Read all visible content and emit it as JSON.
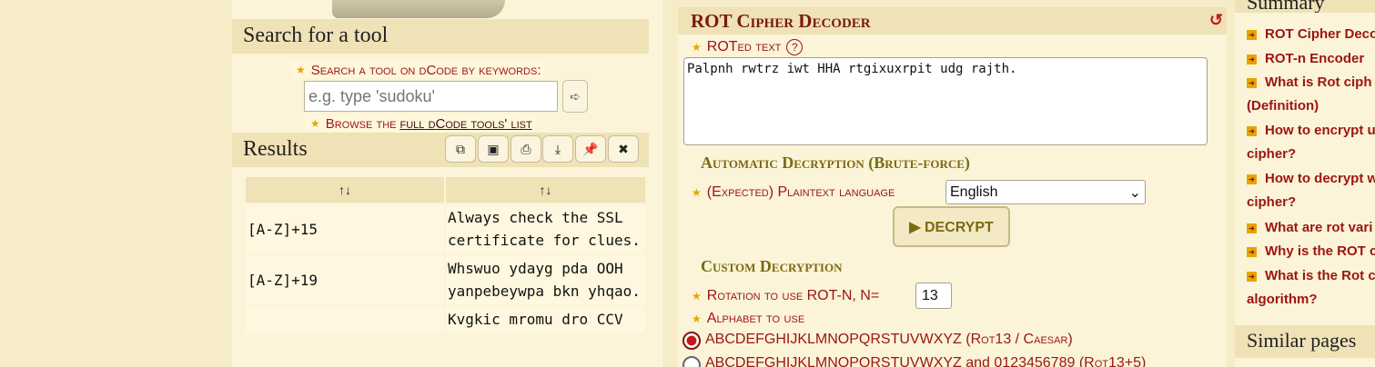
{
  "search_panel": {
    "title": "Search for a tool",
    "label": "Search a tool on dCode by keywords:",
    "placeholder": "e.g. type 'sudoku'",
    "go_icon": "arrow-go-icon",
    "browse_prefix": "Browse the",
    "browse_link": "full dCode tools' list"
  },
  "results_panel": {
    "title": "Results",
    "tools": [
      "copy-icon",
      "image-icon",
      "print-icon",
      "download-icon",
      "pin-icon",
      "close-icon"
    ],
    "columns": [
      "↑↓",
      "↑↓"
    ],
    "rows": [
      {
        "key": "[A-Z]+15",
        "value": "Always check the SSL certificate for clues."
      },
      {
        "key": "[A-Z]+19",
        "value": "Whswuo ydayg pda OOH yanpebeywpa bkn yhqao."
      },
      {
        "key": "",
        "value": "Kvgkic mromu dro CCV"
      }
    ]
  },
  "decoder": {
    "title": "ROT Cipher Decoder",
    "roted_label": "ROTed text",
    "help": "?",
    "text": "Palpnh rwtrz iwt HHA rtgixuxrpit udg rajth.",
    "auto_title": "Automatic Decryption (Brute-force)",
    "lang_label": "(Expected) Plaintext language",
    "lang_value": "English",
    "decrypt_label": "▶ DECRYPT",
    "custom_title": "Custom Decryption",
    "rotation_label": "Rotation to use ROT-N, N=",
    "rotation_value": "13",
    "alphabet_label": "Alphabet to use",
    "alphabet_opt1": "ABCDEFGHIJKLMNOPQRSTUVWXYZ",
    "alphabet_opt1_tag": "(Rot13 / Caesar)",
    "alphabet_opt2": "ABCDEFGHIJKLMNOPQRSTUVWXYZ and 0123456789",
    "alphabet_opt2_tag": "(Rot13+5)"
  },
  "summary": {
    "title": "Summary",
    "items": [
      "ROT Cipher Deco",
      "ROT-n Encoder",
      "What is Rot ciph",
      "(Definition)",
      "How to encrypt u",
      "cipher?",
      "How to decrypt w",
      "cipher?",
      "What are rot vari",
      "Why is the ROT c",
      "What is the Rot c",
      "algorithm?"
    ],
    "similar_title": "Similar pages"
  }
}
